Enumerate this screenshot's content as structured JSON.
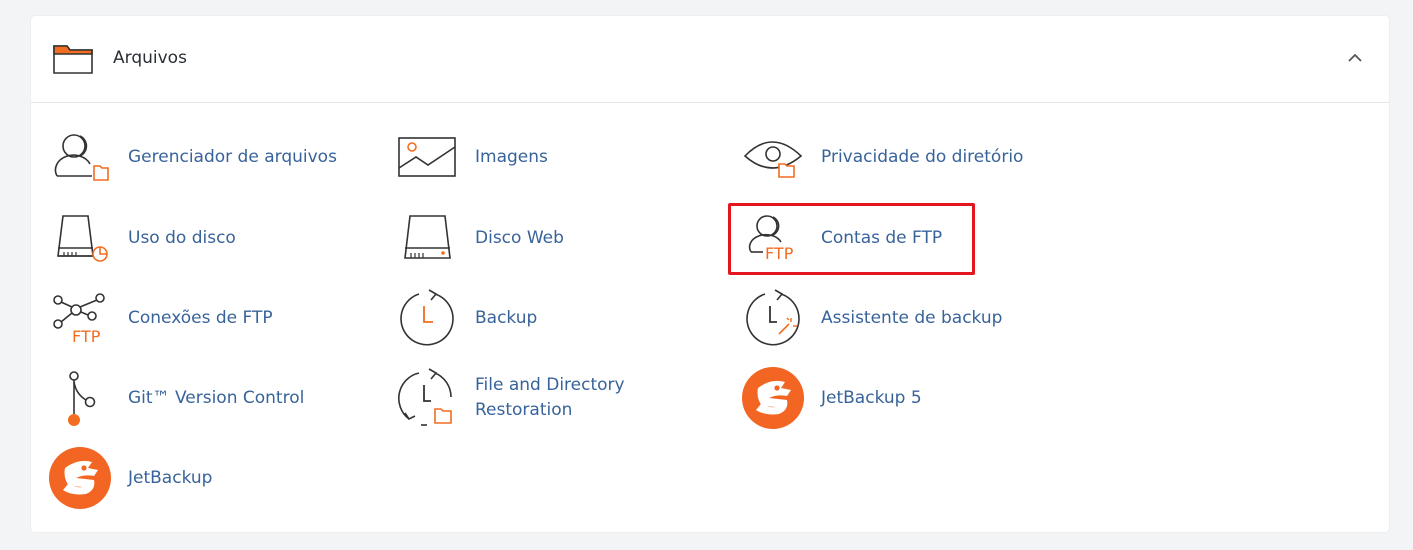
{
  "section": {
    "title": "Arquivos",
    "icon": "folder-icon",
    "collapse_icon": "chevron-up-icon"
  },
  "items": [
    {
      "label": "Gerenciador de arquivos",
      "icon": "file-manager-icon"
    },
    {
      "label": "Imagens",
      "icon": "image-icon"
    },
    {
      "label": "Privacidade do diretório",
      "icon": "eye-folder-icon"
    },
    {
      "label": "Uso do disco",
      "icon": "disk-usage-icon"
    },
    {
      "label": "Disco Web",
      "icon": "web-disk-icon"
    },
    {
      "label": "Contas de FTP",
      "icon": "ftp-accounts-icon",
      "icon_text": "FTP"
    },
    {
      "label": "Conexões de FTP",
      "icon": "ftp-connections-icon",
      "icon_text": "FTP"
    },
    {
      "label": "Backup",
      "icon": "backup-icon"
    },
    {
      "label": "Assistente de backup",
      "icon": "backup-wizard-icon"
    },
    {
      "label": "Git™ Version Control",
      "icon": "git-icon"
    },
    {
      "label": "File and Directory Restoration",
      "icon": "restore-icon"
    },
    {
      "label": "JetBackup 5",
      "icon": "jetbackup-logo-icon"
    },
    {
      "label": "JetBackup",
      "icon": "jetbackup-logo-icon"
    }
  ],
  "highlighted_item": "Contas de FTP",
  "colors": {
    "accent": "#f26d21",
    "link": "#38639a",
    "icon_stroke": "#333333",
    "highlight_border": "#e3151e",
    "jetbackup_orange": "#f26522"
  }
}
